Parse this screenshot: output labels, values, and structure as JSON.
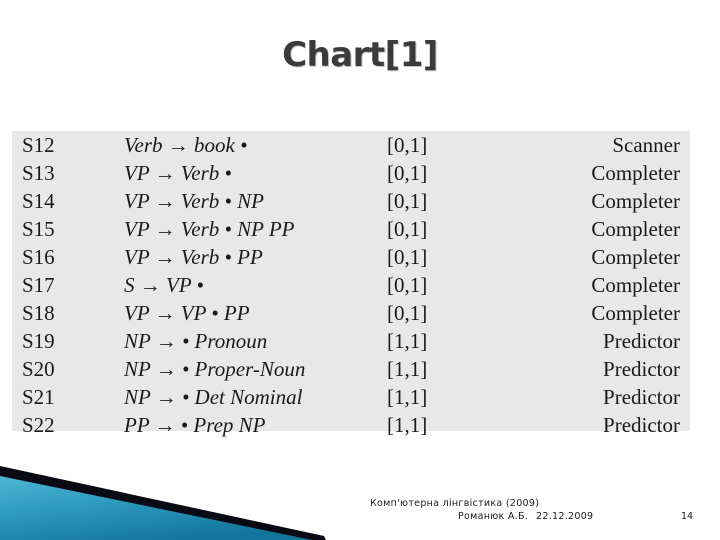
{
  "slide": {
    "title": "Chart[1]",
    "title_color": "#3b3b3b",
    "background_color": "#ffffff",
    "table_background_color": "#e8e8e8"
  },
  "chart_table": {
    "rows": [
      {
        "state": "S12",
        "rule": "Verb → book •",
        "span": "[0,1]",
        "operation": "Scanner"
      },
      {
        "state": "S13",
        "rule": "VP → Verb •",
        "span": "[0,1]",
        "operation": "Completer"
      },
      {
        "state": "S14",
        "rule": "VP → Verb • NP",
        "span": "[0,1]",
        "operation": "Completer"
      },
      {
        "state": "S15",
        "rule": "VP → Verb • NP PP",
        "span": "[0,1]",
        "operation": "Completer"
      },
      {
        "state": "S16",
        "rule": "VP → Verb • PP",
        "span": "[0,1]",
        "operation": "Completer"
      },
      {
        "state": "S17",
        "rule": "S → VP •",
        "span": "[0,1]",
        "operation": "Completer"
      },
      {
        "state": "S18",
        "rule": "VP → VP • PP",
        "span": "[0,1]",
        "operation": "Completer"
      },
      {
        "state": "S19",
        "rule": "NP → • Pronoun",
        "span": "[1,1]",
        "operation": "Predictor"
      },
      {
        "state": "S20",
        "rule": "NP → • Proper-Noun",
        "span": "[1,1]",
        "operation": "Predictor"
      },
      {
        "state": "S21",
        "rule": "NP → • Det Nominal",
        "span": "[1,1]",
        "operation": "Predictor"
      },
      {
        "state": "S22",
        "rule": "PP → • Prep NP",
        "span": "[1,1]",
        "operation": "Predictor"
      }
    ]
  },
  "footer": {
    "course": "Комп'ютерна лінгвістика (2009)",
    "author": "Романюк А.Б.",
    "date": "22.12.2009",
    "page_number": "14"
  },
  "decoration": {
    "teal_light": "#4fb6d4",
    "teal_dark": "#1b7e9e",
    "stripe_color": "#0a0a14"
  }
}
